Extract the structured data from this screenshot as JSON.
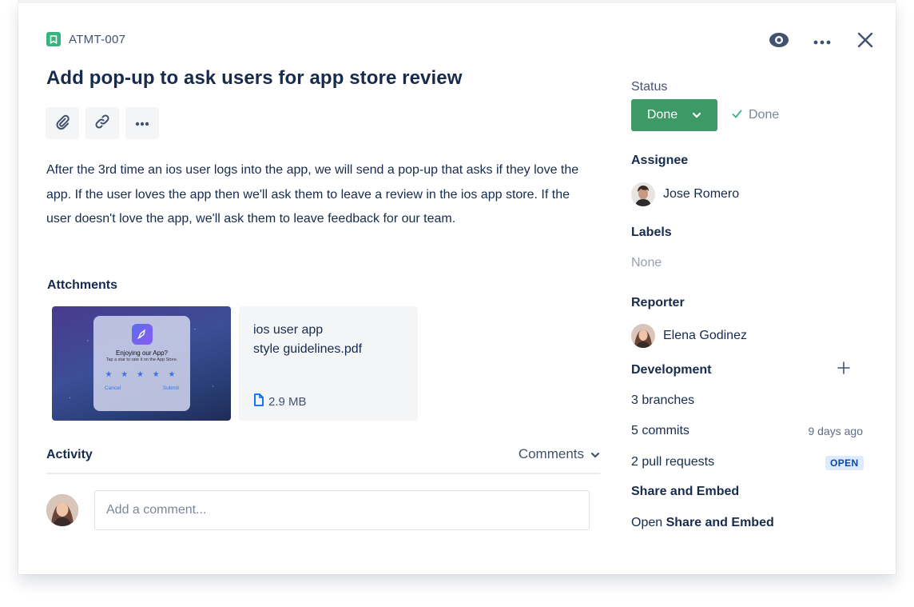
{
  "issue": {
    "key": "ATMT-007",
    "title": "Add pop-up to ask users for app store review",
    "description": "After the 3rd time an ios user logs into the app, we will send a pop-up that asks if they love the app. If the user loves the app then we'll ask them to leave a review in the ios app store. If the user doesn't love the app, we'll ask them to leave feedback for our team."
  },
  "toolbar": {
    "attach_icon": "paperclip-icon",
    "link_icon": "link-icon",
    "more_icon": "ellipsis-icon"
  },
  "top_actions": {
    "watch_icon": "eye-icon",
    "more_icon": "ellipsis-icon",
    "close_icon": "close-icon"
  },
  "attachments": {
    "heading": "Attchments",
    "image": {
      "dialog_title": "Enjoying our App?",
      "dialog_sub": "Tap a star to rate it on the App Store.",
      "stars": "★ ★ ★ ★ ★",
      "cancel": "Cancel",
      "submit": "Submit"
    },
    "file": {
      "name_line1": "ios user app",
      "name_line2": "style guidelines.pdf",
      "size": "2.9 MB"
    }
  },
  "activity": {
    "heading": "Activity",
    "sort_label": "Comments",
    "comment_placeholder": "Add a comment..."
  },
  "sidebar": {
    "status_label": "Status",
    "status_value": "Done",
    "resolution": "Done",
    "assignee_label": "Assignee",
    "assignee_name": "Jose Romero",
    "labels_label": "Labels",
    "labels_value": "None",
    "reporter_label": "Reporter",
    "reporter_name": "Elena Godinez",
    "development_label": "Development",
    "branches": "3 branches",
    "commits": "5 commits",
    "commits_age": "9 days ago",
    "pull_requests": "2 pull requests",
    "pr_status": "OPEN",
    "share_label": "Share and Embed",
    "share_link_prefix": "Open",
    "share_link_bold": "Share and Embed"
  },
  "colors": {
    "done_green": "#3d9966",
    "story_green": "#36b37e",
    "text_dark": "#172b4d",
    "lozenge_bg": "#deebff",
    "lozenge_text": "#0747a6"
  }
}
